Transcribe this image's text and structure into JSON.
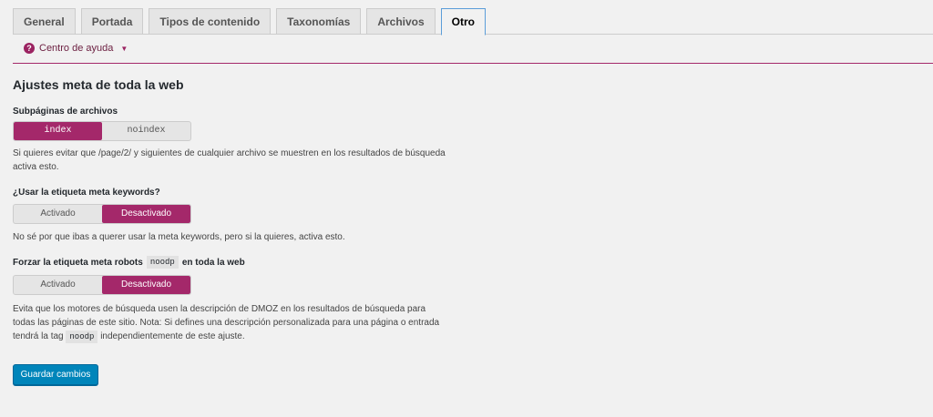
{
  "tabs": [
    {
      "label": "General"
    },
    {
      "label": "Portada"
    },
    {
      "label": "Tipos de contenido"
    },
    {
      "label": "Taxonomías"
    },
    {
      "label": "Archivos"
    },
    {
      "label": "Otro"
    }
  ],
  "active_tab": "Otro",
  "help": {
    "label": "Centro de ayuda",
    "icon": "help-circle-icon"
  },
  "section_title": "Ajustes meta de toda la web",
  "archives": {
    "label": "Subpáginas de archivos",
    "options": [
      "index",
      "noindex"
    ],
    "selected": "index",
    "description": "Si quieres evitar que /page/2/ y siguientes de cualquier archivo se muestren en los resultados de búsqueda activa esto."
  },
  "keywords": {
    "label": "¿Usar la etiqueta meta keywords?",
    "options": [
      "Activado",
      "Desactivado"
    ],
    "selected": "Desactivado",
    "description": "No sé por que ibas a querer usar la meta keywords, pero si la quieres, activa esto."
  },
  "noodp": {
    "label_before": "Forzar la etiqueta meta robots",
    "code": "noodp",
    "label_after": "en toda la web",
    "options": [
      "Activado",
      "Desactivado"
    ],
    "selected": "Desactivado",
    "description_before": "Evita que los motores de búsqueda usen la descripción de DMOZ en los resultados de búsqueda para todas las páginas de este sitio. Nota: Si defines una descripción personalizada para una página o entrada tendrá la tag",
    "description_code": "noodp",
    "description_after": "independientemente de este ajuste."
  },
  "save_label": "Guardar cambios",
  "colors": {
    "accent": "#a4286a",
    "primary_button": "#0085ba"
  }
}
